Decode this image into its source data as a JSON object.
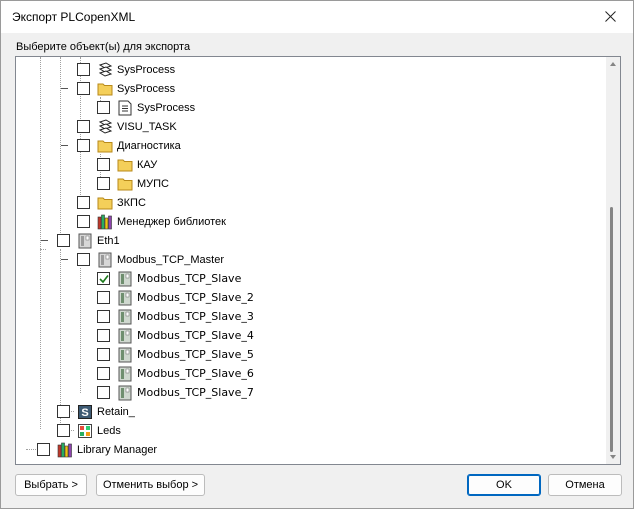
{
  "window": {
    "title": "Экспорт PLCopenXML"
  },
  "caption": "Выберите объект(ы) для экспорта",
  "tree": [
    {
      "label": "SysProcess",
      "icon": "task-icon",
      "checked": false,
      "name": "tree-item-sysprocess-task"
    },
    {
      "label": "SysProcess",
      "icon": "folder-icon",
      "checked": false,
      "name": "tree-item-sysprocess-folder"
    },
    {
      "label": "SysProcess",
      "icon": "program-icon",
      "checked": false,
      "name": "tree-item-sysprocess-program"
    },
    {
      "label": "VISU_TASK",
      "icon": "task-icon",
      "checked": false,
      "name": "tree-item-visu-task"
    },
    {
      "label": "Диагностика",
      "icon": "folder-icon",
      "checked": false,
      "name": "tree-item-diagnostics"
    },
    {
      "label": "КАУ",
      "icon": "folder-icon",
      "checked": false,
      "name": "tree-item-kau"
    },
    {
      "label": "МУПС",
      "icon": "folder-icon",
      "checked": false,
      "name": "tree-item-mups"
    },
    {
      "label": "ЗКПС",
      "icon": "folder-icon",
      "checked": false,
      "name": "tree-item-zkps"
    },
    {
      "label": "Менеджер библиотек",
      "icon": "library-icon",
      "checked": false,
      "name": "tree-item-library-manager-ru"
    },
    {
      "label": "Eth1",
      "icon": "device-icon",
      "checked": false,
      "name": "tree-item-eth1"
    },
    {
      "label": "Modbus_TCP_Master",
      "icon": "device-icon",
      "checked": false,
      "name": "tree-item-modbus-master"
    },
    {
      "label": "Modbus_TCP_Slave",
      "icon": "device-icon",
      "checked": true,
      "name": "tree-item-modbus-slave"
    },
    {
      "label": "Modbus_TCP_Slave_2",
      "icon": "device-icon",
      "checked": false,
      "name": "tree-item-modbus-slave-2"
    },
    {
      "label": "Modbus_TCP_Slave_3",
      "icon": "device-icon",
      "checked": false,
      "name": "tree-item-modbus-slave-3"
    },
    {
      "label": "Modbus_TCP_Slave_4",
      "icon": "device-icon",
      "checked": false,
      "name": "tree-item-modbus-slave-4"
    },
    {
      "label": "Modbus_TCP_Slave_5",
      "icon": "device-icon",
      "checked": false,
      "name": "tree-item-modbus-slave-5"
    },
    {
      "label": "Modbus_TCP_Slave_6",
      "icon": "device-icon",
      "checked": false,
      "name": "tree-item-modbus-slave-6"
    },
    {
      "label": "Modbus_TCP_Slave_7",
      "icon": "device-icon",
      "checked": false,
      "name": "tree-item-modbus-slave-7"
    },
    {
      "label": "Retain_",
      "icon": "retain-icon",
      "checked": false,
      "name": "tree-item-retain"
    },
    {
      "label": "Leds",
      "icon": "leds-icon",
      "checked": false,
      "name": "tree-item-leds"
    },
    {
      "label": "Library Manager",
      "icon": "library-icon",
      "checked": false,
      "name": "tree-item-library-manager"
    }
  ],
  "buttons": {
    "select": "Выбрать >",
    "deselect": "Отменить выбор >",
    "ok": "OK",
    "cancel": "Отмена"
  },
  "colors": {
    "accent": "#0067c0",
    "folder": "#e8b830",
    "check": "#1a7a1a"
  }
}
